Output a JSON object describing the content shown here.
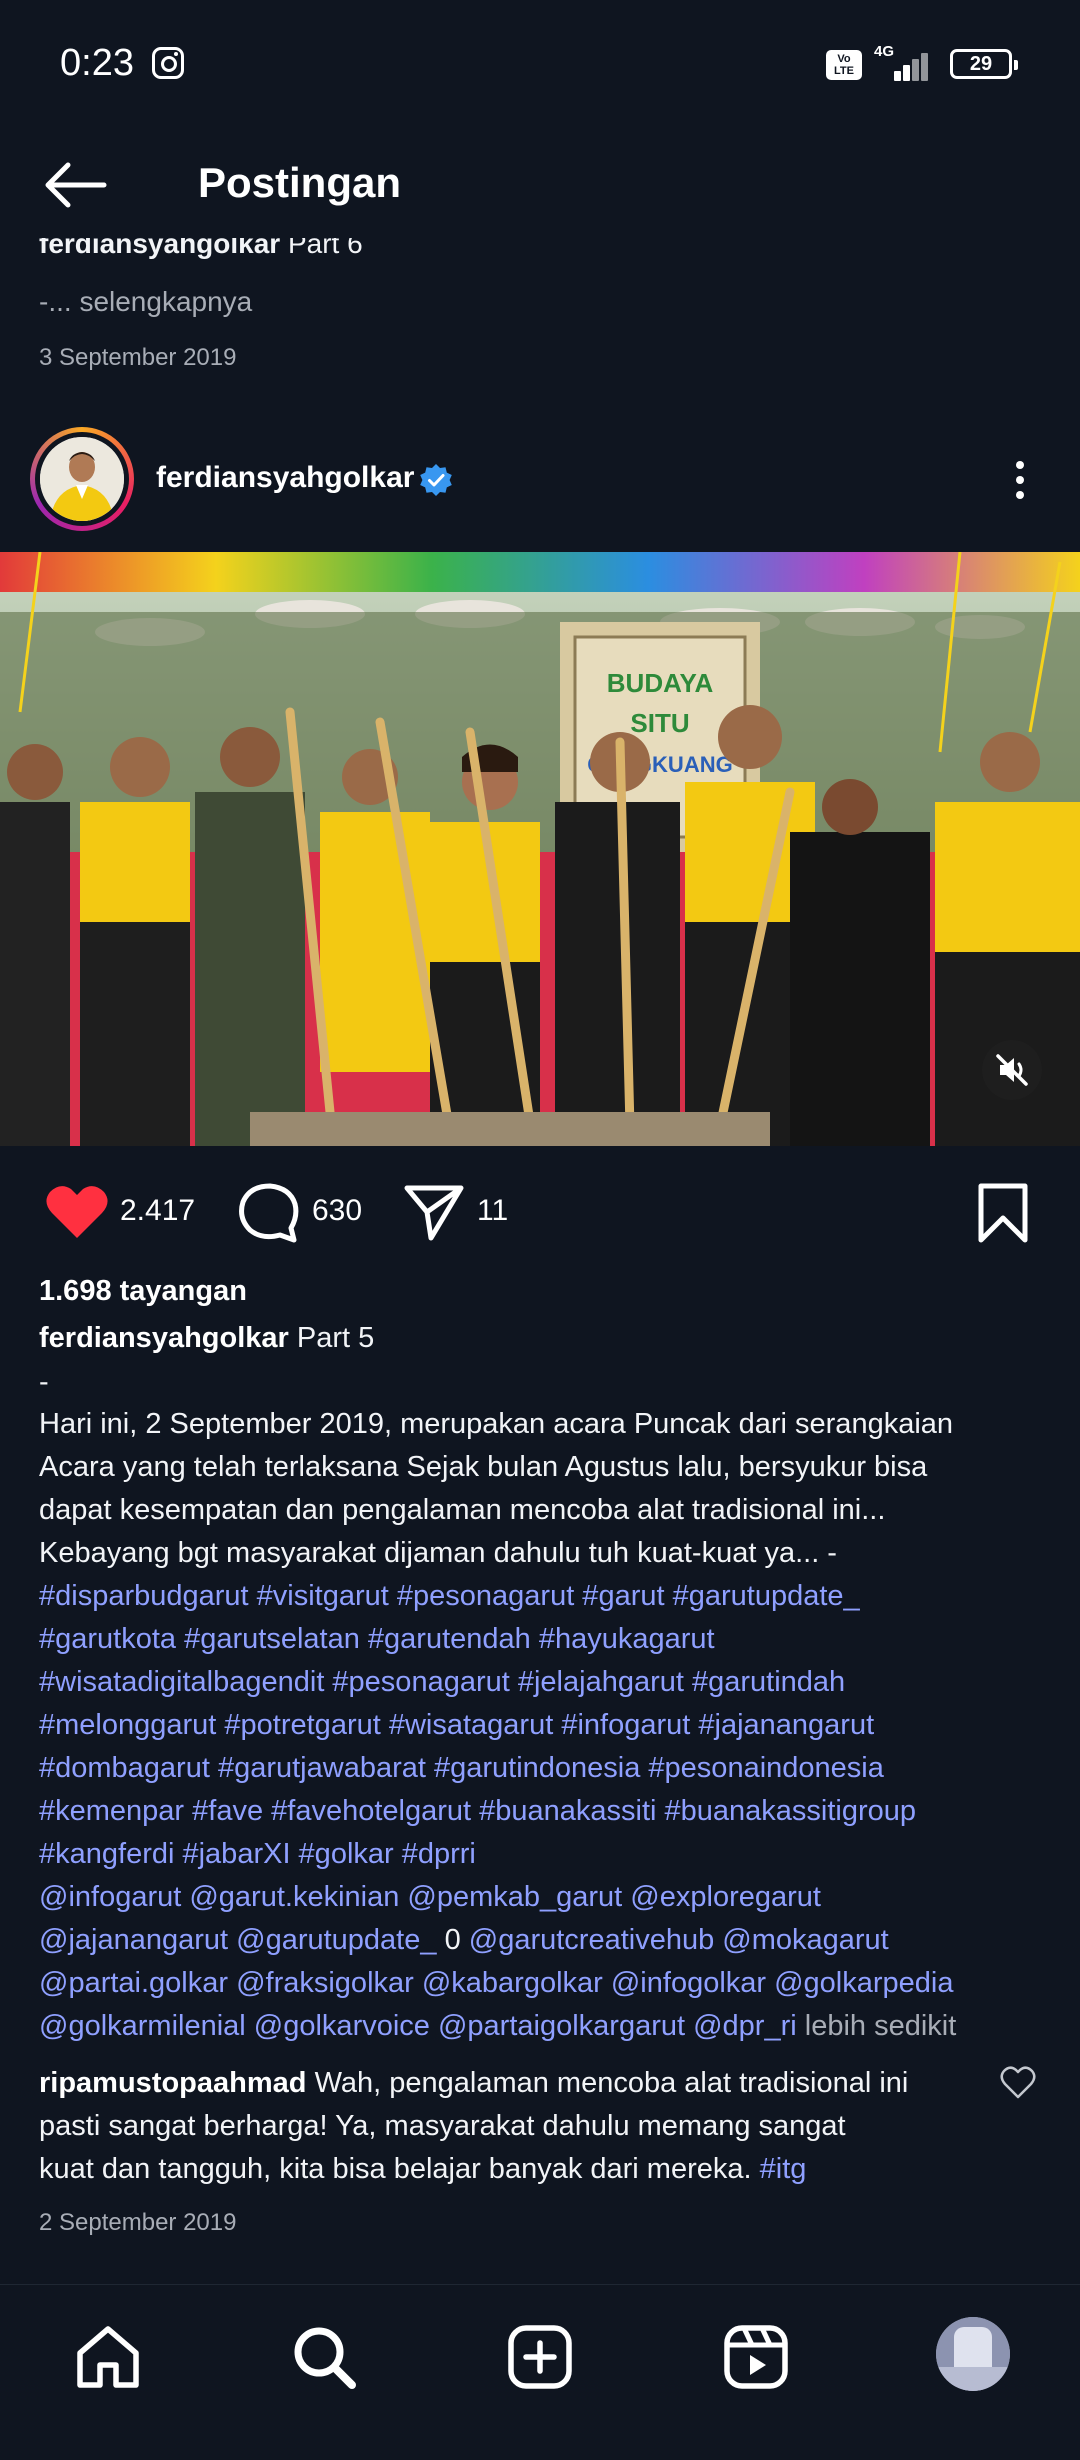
{
  "status_bar": {
    "time": "0:23",
    "network": "4G",
    "volte": "Vo LTE",
    "battery": "29"
  },
  "header": {
    "title": "Postingan"
  },
  "previous_post": {
    "username": "ferdiansyahgolkar",
    "caption_part": "Part 6",
    "more_label": "-... selengkapnya",
    "date": "3 September 2019"
  },
  "post": {
    "username": "ferdiansyahgolkar",
    "likes": "2.417",
    "comments": "630",
    "shares": "11",
    "views": "1.698 tayangan",
    "caption_part": "Part 5",
    "caption_dash": "-",
    "caption_lines": [
      "Hari ini, 2 September 2019, merupakan acara Puncak dari serangkaian",
      "Acara yang telah terlaksana Sejak bulan Agustus lalu, bersyukur bisa",
      "dapat kesempatan dan pengalaman mencoba alat tradisional ini...",
      "Kebayang bgt masyarakat dijaman dahulu tuh kuat-kuat ya... -"
    ],
    "hashtag_lines": [
      "#disparbudgarut #visitgarut #pesonagarut #garut #garutupdate_",
      "#garutkota #garutselatan #garutendah #hayukagarut",
      "#wisatadigitalbagendit #pesonagarut #jelajahgarut #garutindah",
      "#melonggarut #potretgarut #wisatagarut #infogarut #jajanangarut",
      "#dombagarut #garutjawabarat #garutindonesia #pesonaindonesia",
      "#kemenpar #fave #favehotelgarut #buanakassiti #buanakassitigroup",
      "#kangferdi #jabarXI #golkar #dprri",
      "@infogarut @garut.kekinian @pemkab_garut @exploregarut"
    ],
    "mention_line_a": "@jajanangarut @garutupdate_",
    "mention_line_a_zero": "0",
    "mention_line_a_end": "@garutcreativehub @mokagarut",
    "mention_line_b": "@partai.golkar @fraksigolkar @kabargolkar @infogolkar @golkarpedia",
    "mention_line_c": "@golkarmilenial @golkarvoice @partaigolkargarut @dpr_ri",
    "less_label": "lebih sedikit",
    "date": "2 September 2019"
  },
  "comment": {
    "username": "ripamustopaahmad",
    "text_1": "Wah, pengalaman mencoba alat tradisional ini",
    "text_2": "pasti sangat berharga! Ya, masyarakat dahulu memang sangat",
    "text_3": "kuat dan tangguh, kita bisa belajar banyak dari mereka.",
    "tag": "#itg"
  },
  "photo_sign": {
    "line1": "BUDAYA",
    "line2": "SITU",
    "line3": "CANGKUANG"
  },
  "colors": {
    "background": "#0f1520",
    "link": "#8fa0ff",
    "like": "#ff3040",
    "verified": "#3897f0"
  },
  "icons": [
    "back-arrow-icon",
    "instagram-icon",
    "verified-badge-icon",
    "more-options-icon",
    "heart-icon",
    "comment-icon",
    "share-icon",
    "bookmark-icon",
    "mute-icon",
    "home-icon",
    "search-icon",
    "add-icon",
    "reels-icon"
  ]
}
